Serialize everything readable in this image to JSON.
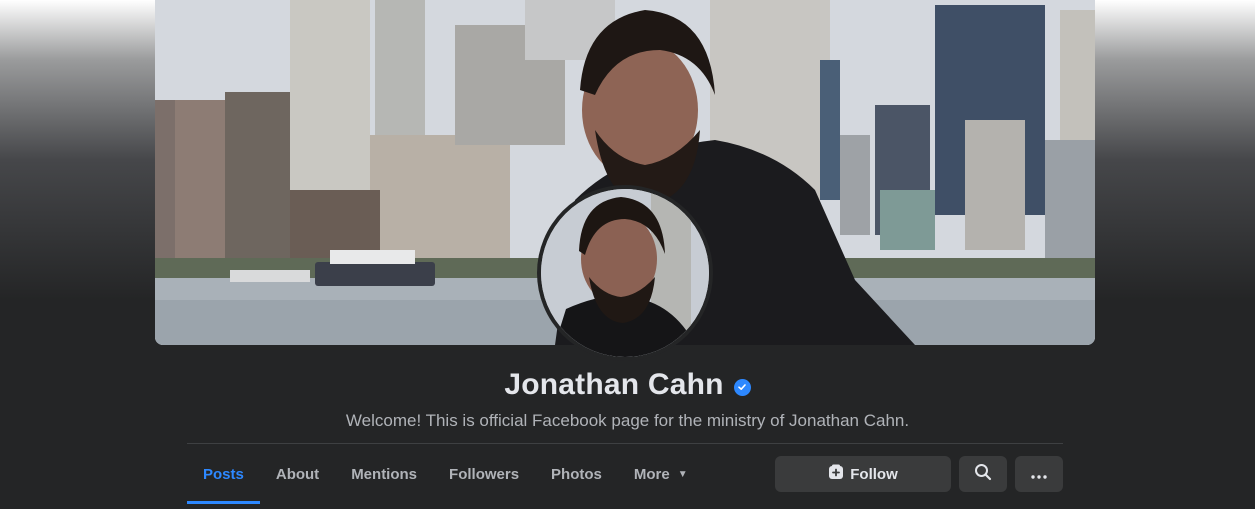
{
  "profile": {
    "name": "Jonathan Cahn",
    "subtitle": "Welcome! This is official Facebook page for the ministry of Jonathan Cahn."
  },
  "tabs": [
    {
      "label": "Posts",
      "active": true
    },
    {
      "label": "About"
    },
    {
      "label": "Mentions"
    },
    {
      "label": "Followers"
    },
    {
      "label": "Photos"
    },
    {
      "label": "More",
      "caret": "▼"
    }
  ],
  "actions": {
    "follow_label": "Follow",
    "follow_icon": "add-page-icon",
    "search_icon": "search-icon",
    "more_icon": "ellipsis-icon"
  },
  "colors": {
    "accent": "#2d88ff",
    "background": "#242526",
    "button": "#3a3b3c"
  }
}
